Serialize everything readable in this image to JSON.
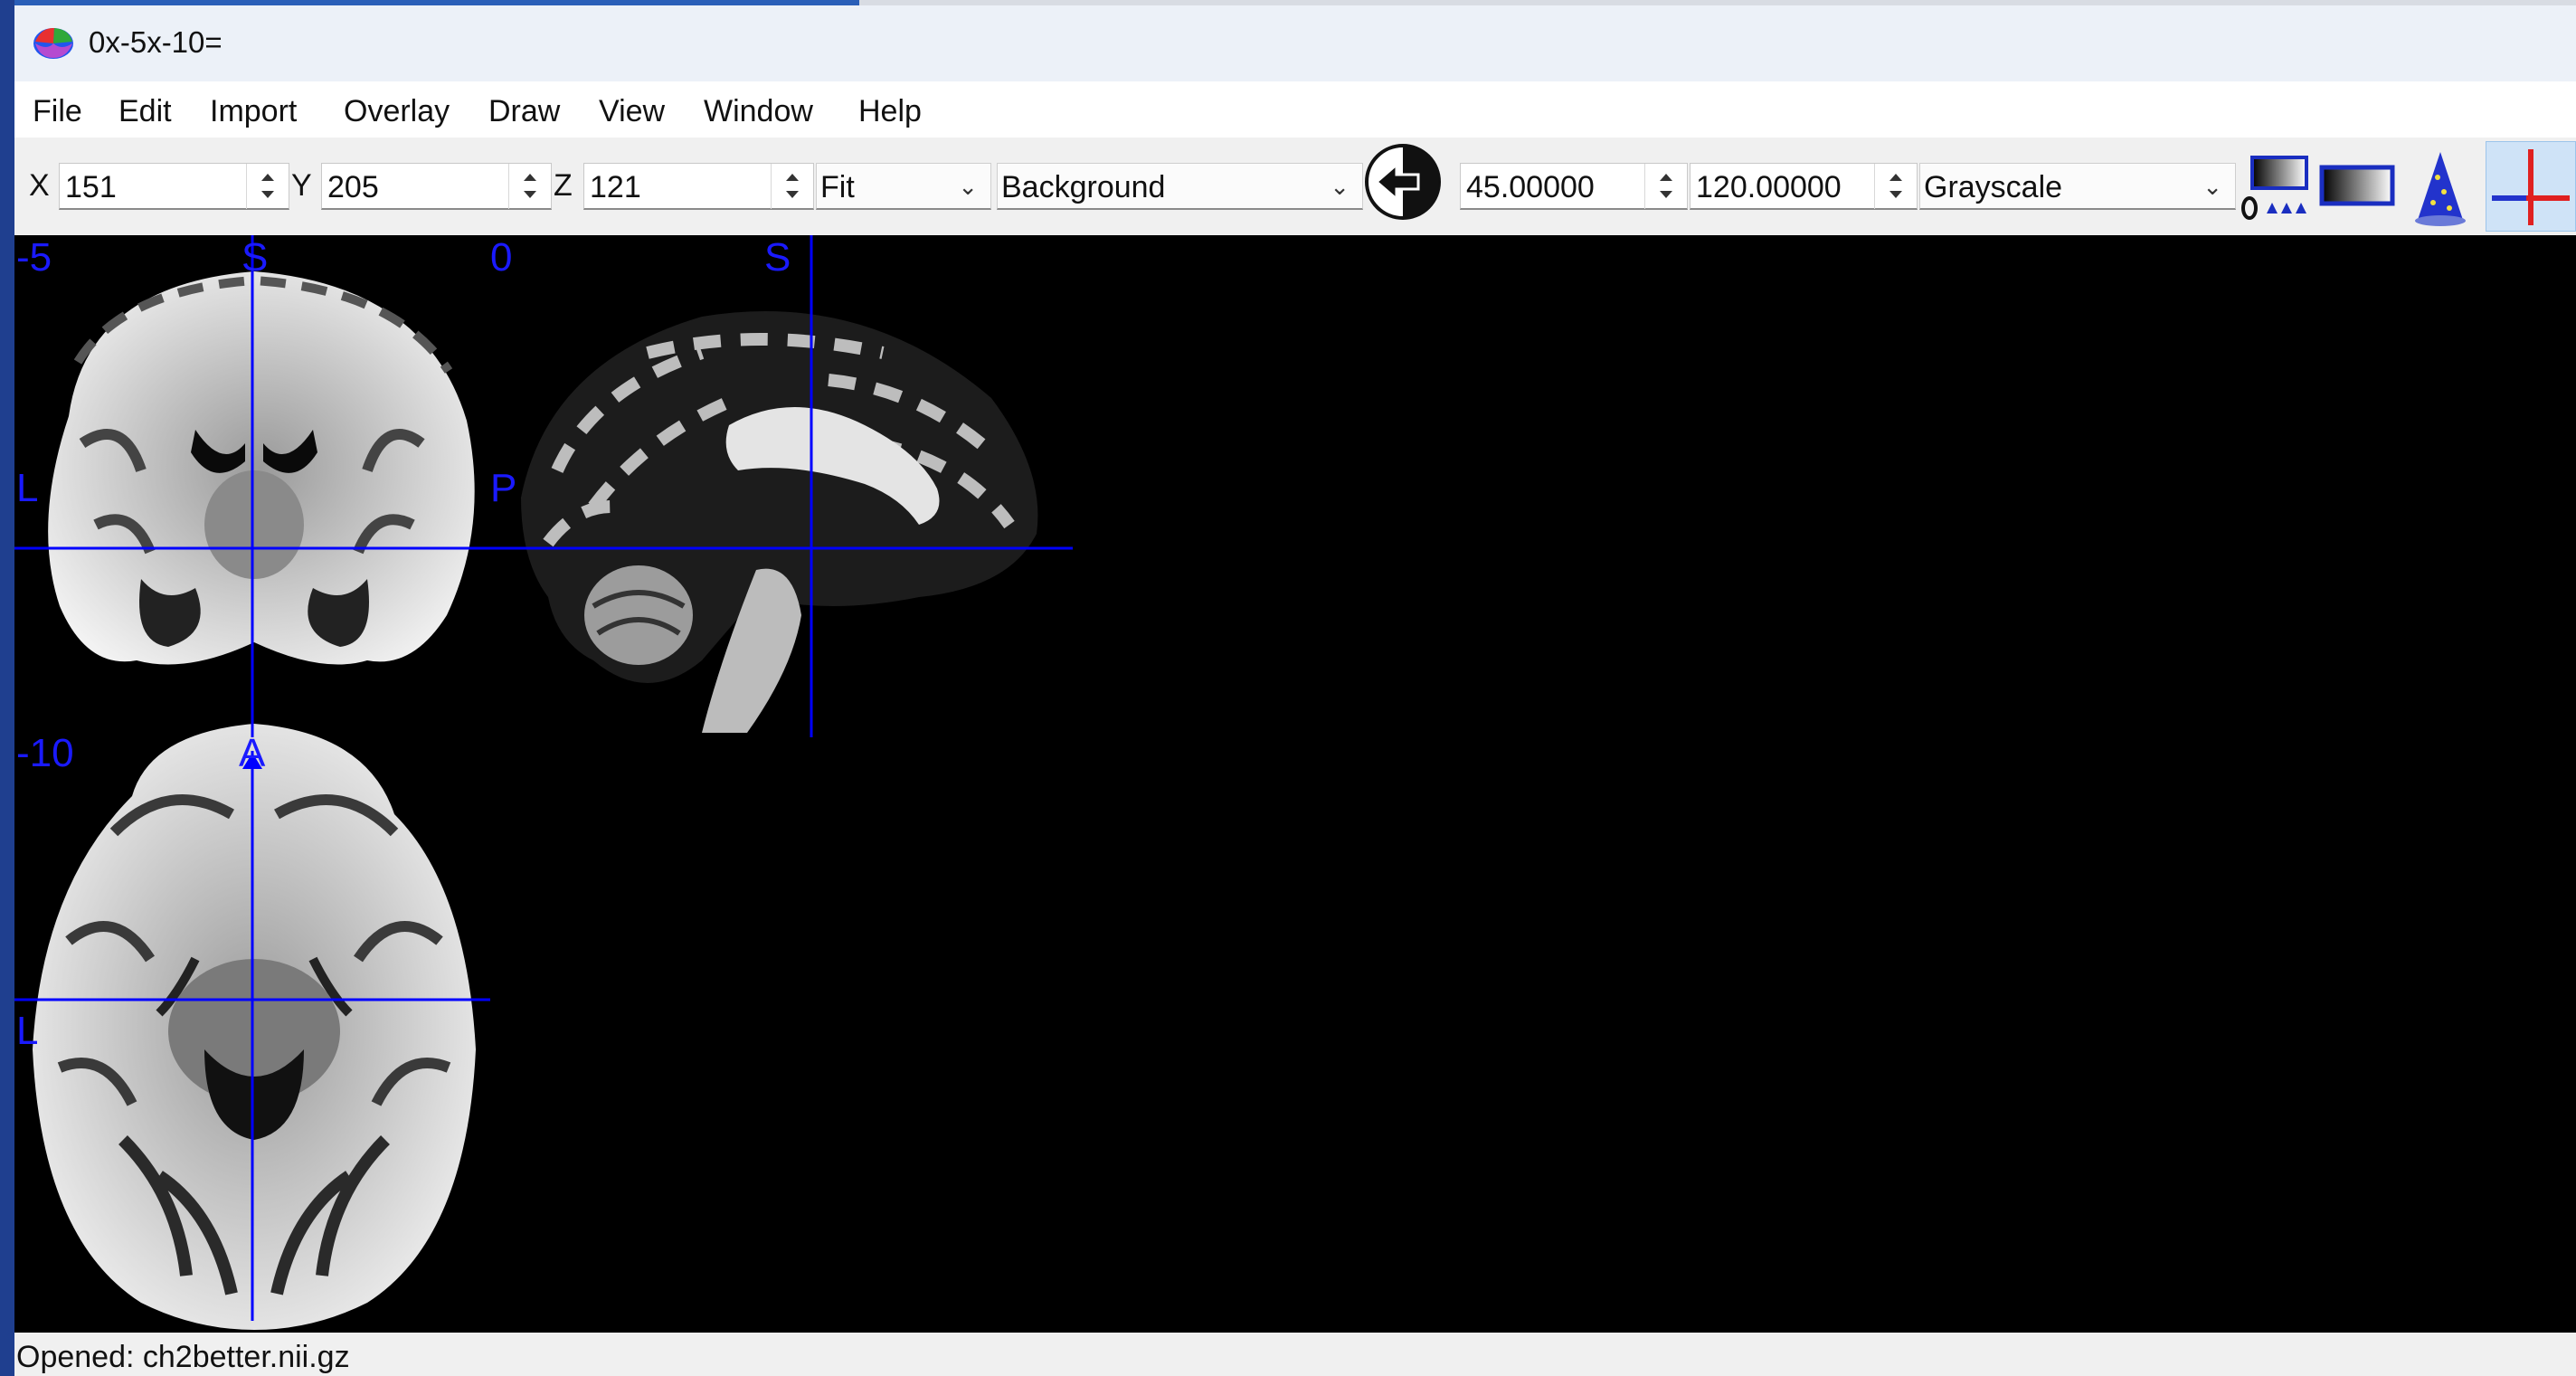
{
  "window": {
    "title": "0x-5x-10="
  },
  "menu": [
    "File",
    "Edit",
    "Import",
    "Overlay",
    "Draw",
    "View",
    "Window",
    "Help"
  ],
  "toolbar": {
    "x_label": "X",
    "x_value": "151",
    "y_label": "Y",
    "y_value": "205",
    "z_label": "Z",
    "z_value": "121",
    "zoom": "Fit",
    "layer": "Background",
    "window_min": "45.00000",
    "window_max": "120.00000",
    "colormap": "Grayscale"
  },
  "viewer": {
    "coronal": {
      "slice": "-5",
      "top": "S",
      "left": "L"
    },
    "sagittal": {
      "slice": "0",
      "top": "S",
      "left": "P"
    },
    "axial": {
      "slice": "-10",
      "top": "A",
      "left": "L"
    }
  },
  "status": "Opened: ch2better.nii.gz",
  "colors": {
    "crosshair": "#0000ff",
    "viewer_bg": "#000000",
    "toolbar_bg": "#f0f0f0"
  }
}
